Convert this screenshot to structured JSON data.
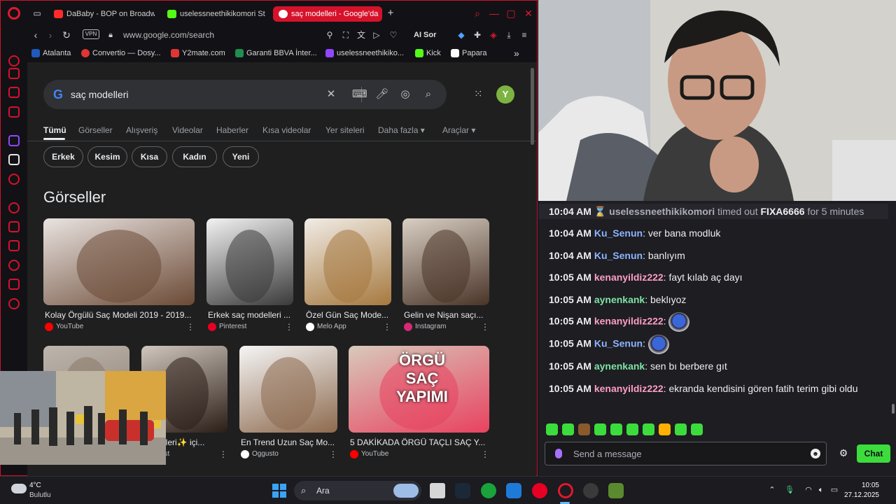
{
  "browser": {
    "tabs": [
      {
        "label": "DaBaby - BOP on Broadw",
        "favicon_color": "#ff2b2b",
        "active": false
      },
      {
        "label": "uselessneethikikomori St",
        "favicon_color": "#53fc18",
        "active": false
      },
      {
        "label": "saç modelleri - Google'da",
        "favicon_color": "#ffffff",
        "active": true
      }
    ],
    "new_tab_label": "+",
    "address": {
      "vpn_label": "VPN",
      "url": "www.google.com/search",
      "ai_label": "AI Sor"
    },
    "bookmarks": [
      {
        "label": "Atalanta",
        "color": "#1e5bbd"
      },
      {
        "label": "Convertio — Dosy...",
        "color": "#e03535"
      },
      {
        "label": "Y2mate.com",
        "color": "#e03535"
      },
      {
        "label": "Garanti BBVA İnter...",
        "color": "#1f8f4e"
      },
      {
        "label": "uselessneethikiko...",
        "color": "#9146ff"
      },
      {
        "label": "Kick",
        "color": "#53fc18"
      },
      {
        "label": "Papara",
        "color": "#ffffff"
      }
    ],
    "bookmarks_more": "»"
  },
  "google": {
    "logo": "G",
    "query": "saç modelleri",
    "avatar_letter": "Y",
    "tabs": [
      "Tümü",
      "Görseller",
      "Alışveriş",
      "Videolar",
      "Haberler",
      "Kısa videolar",
      "Yer siteleri",
      "Daha fazla ▾",
      "Araçlar ▾"
    ],
    "chips": [
      "Erkek",
      "Kesim",
      "Kısa",
      "Kadın",
      "Yeni"
    ],
    "section_title": "Görseller",
    "images_row1": [
      {
        "title": "Kolay Örgülü Saç Modeli 2019 - 2019...",
        "source": "YouTube",
        "source_color": "#ff0000",
        "colors": [
          "#e9e3e0",
          "#6b4a36"
        ]
      },
      {
        "title": "Erkek saç modelleri ...",
        "source": "Pinterest",
        "source_color": "#e60023",
        "colors": [
          "#f2f2f2",
          "#3a3a3a"
        ]
      },
      {
        "title": "Özel Gün Saç Mode...",
        "source": "Melo App",
        "source_color": "#ffffff",
        "colors": [
          "#f1ece6",
          "#a6793f"
        ]
      },
      {
        "title": "Gelin ve Nişan saçı...",
        "source": "Instagram",
        "source_color": "#d62976",
        "colors": [
          "#d9cfc4",
          "#4a3428"
        ]
      }
    ],
    "images_row2": [
      {
        "title": "",
        "source": "",
        "source_color": "#e60023",
        "colors": [
          "#bdb6ae",
          "#8a7a6a"
        ]
      },
      {
        "title": "modelleri✨ içi...",
        "source": "erest",
        "source_color": "#e60023",
        "colors": [
          "#cfc6bd",
          "#2b1d17"
        ]
      },
      {
        "title": "En Trend Uzun Saç Mo...",
        "source": "Oggusto",
        "source_color": "#ffffff",
        "colors": [
          "#f5f5f5",
          "#8d6a4e"
        ]
      },
      {
        "title": "5 DAKİKADA ÖRGÜ TAÇLI SAÇ Y...",
        "source": "YouTube",
        "source_color": "#ff0000",
        "colors": [
          "#d8c9bb",
          "#e8425f"
        ]
      }
    ],
    "row2_overlay_text": [
      "ÖRGÜ",
      "SAÇ",
      "YAPIMI"
    ]
  },
  "chat": {
    "messages": [
      {
        "time": "10:04 AM",
        "user": "uselessneethikikomori",
        "user_color": "#adadb8",
        "text": " timed out ",
        "target": "FIXA6666",
        "suffix": " for 5 minutes",
        "system": true
      },
      {
        "time": "10:04 AM",
        "user": "Ku_Senun",
        "user_color": "#8eb4ff",
        "text": ": ver bana modluk"
      },
      {
        "time": "10:04 AM",
        "user": "Ku_Senun",
        "user_color": "#8eb4ff",
        "text": ": banlıyım"
      },
      {
        "time": "10:05 AM",
        "user": "kenanyildiz222",
        "user_color": "#ff9ec6",
        "text": ": fayt kılab aç dayı"
      },
      {
        "time": "10:05 AM",
        "user": "aynenkank",
        "user_color": "#7fe3a7",
        "text": ": beklıyoz"
      },
      {
        "time": "10:05 AM",
        "user": "kenanyildiz222",
        "user_color": "#ff9ec6",
        "text": ": ",
        "emote": true
      },
      {
        "time": "10:05 AM",
        "user": "Ku_Senun",
        "user_color": "#8eb4ff",
        "text": ": ",
        "emote": true
      },
      {
        "time": "10:05 AM",
        "user": "aynenkank",
        "user_color": "#7fe3a7",
        "text": ": sen bı berbere gıt"
      },
      {
        "time": "10:05 AM",
        "user": "kenanyildiz222",
        "user_color": "#ff9ec6",
        "text": ": ekranda kendisini gören fatih terim gibi oldu"
      }
    ],
    "emote_bar_colors": [
      "#3ddc3d",
      "#3ddc3d",
      "#8a5a2b",
      "#3ddc3d",
      "#3ddc3d",
      "#3ddc3d",
      "#3ddc3d",
      "#ffb000",
      "#3ddc3d",
      "#3ddc3d"
    ],
    "input_placeholder": "Send a message",
    "send_label": "Chat"
  },
  "taskbar": {
    "temperature": "4°C",
    "condition": "Bulutlu",
    "search_label": "Ara",
    "time": "10:05",
    "date": "27.12.2025"
  }
}
